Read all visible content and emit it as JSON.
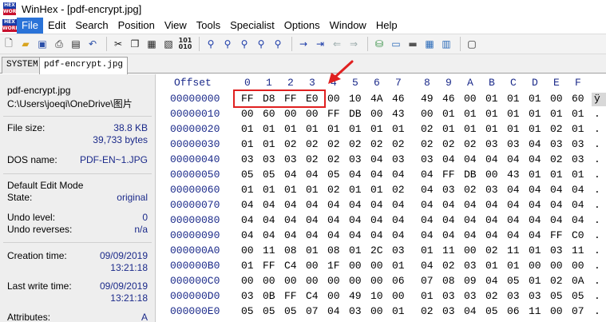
{
  "window": {
    "title": "WinHex - [pdf-encrypt.jpg]",
    "icon_top": "HEX",
    "icon_bottom": "WORKS"
  },
  "menu": {
    "items": [
      "File",
      "Edit",
      "Search",
      "Position",
      "View",
      "Tools",
      "Specialist",
      "Options",
      "Window",
      "Help"
    ],
    "active": "File"
  },
  "toolbar": {
    "icons": [
      "new-file-icon",
      "open-folder-icon",
      "save-icon",
      "print-icon",
      "properties-icon",
      "undo-icon",
      "cut-icon",
      "copy-icon",
      "paste-icon",
      "paste-special-icon",
      "binary-icon",
      "find-icon",
      "find-hex-icon",
      "replace-icon",
      "replace-hex-icon",
      "find-next-icon",
      "goto-icon",
      "go-back-icon",
      "go-forward-icon",
      "disk-editor-icon",
      "ram-editor-icon",
      "calculator-icon",
      "hash-icon",
      "settings-icon"
    ],
    "binary_label": "101\n010"
  },
  "tabs": {
    "system": "SYSTEM",
    "file": "pdf-encrypt.jpg"
  },
  "info": {
    "filename": "pdf-encrypt.jpg",
    "path": "C:\\Users\\joeqi\\OneDrive\\图片",
    "file_size_label": "File size:",
    "file_size_kb": "38.8 KB",
    "file_size_bytes": "39,733 bytes",
    "dos_name_label": "DOS name:",
    "dos_name": "PDF-EN~1.JPG",
    "edit_mode_label": "Default Edit Mode",
    "state_label": "State:",
    "state": "original",
    "undo_level_label": "Undo level:",
    "undo_level": "0",
    "undo_reverses_label": "Undo reverses:",
    "undo_reverses": "n/a",
    "creation_label": "Creation time:",
    "creation_date": "09/09/2019",
    "creation_time": "13:21:18",
    "last_write_label": "Last write time:",
    "last_write_date": "09/09/2019",
    "last_write_time": "13:21:18",
    "attributes_label": "Attributes:",
    "attributes": "A"
  },
  "hex": {
    "offset_label": "Offset",
    "columns": [
      "0",
      "1",
      "2",
      "3",
      "4",
      "5",
      "6",
      "7",
      "8",
      "9",
      "A",
      "B",
      "C",
      "D",
      "E",
      "F"
    ],
    "rows": [
      {
        "offset": "00000000",
        "bytes": [
          "FF",
          "D8",
          "FF",
          "E0",
          "00",
          "10",
          "4A",
          "46",
          "49",
          "46",
          "00",
          "01",
          "01",
          "01",
          "00",
          "60"
        ],
        "ascii": "ÿ"
      },
      {
        "offset": "00000010",
        "bytes": [
          "00",
          "60",
          "00",
          "00",
          "FF",
          "DB",
          "00",
          "43",
          "00",
          "01",
          "01",
          "01",
          "01",
          "01",
          "01",
          "01"
        ],
        "ascii": "."
      },
      {
        "offset": "00000020",
        "bytes": [
          "01",
          "01",
          "01",
          "01",
          "01",
          "01",
          "01",
          "01",
          "02",
          "01",
          "01",
          "01",
          "01",
          "01",
          "02",
          "01"
        ],
        "ascii": "."
      },
      {
        "offset": "00000030",
        "bytes": [
          "01",
          "01",
          "02",
          "02",
          "02",
          "02",
          "02",
          "02",
          "02",
          "02",
          "02",
          "03",
          "03",
          "04",
          "03",
          "03"
        ],
        "ascii": "."
      },
      {
        "offset": "00000040",
        "bytes": [
          "03",
          "03",
          "03",
          "02",
          "02",
          "03",
          "04",
          "03",
          "03",
          "04",
          "04",
          "04",
          "04",
          "04",
          "02",
          "03"
        ],
        "ascii": "."
      },
      {
        "offset": "00000050",
        "bytes": [
          "05",
          "05",
          "04",
          "04",
          "05",
          "04",
          "04",
          "04",
          "04",
          "FF",
          "DB",
          "00",
          "43",
          "01",
          "01",
          "01"
        ],
        "ascii": "."
      },
      {
        "offset": "00000060",
        "bytes": [
          "01",
          "01",
          "01",
          "01",
          "02",
          "01",
          "01",
          "02",
          "04",
          "03",
          "02",
          "03",
          "04",
          "04",
          "04",
          "04"
        ],
        "ascii": "."
      },
      {
        "offset": "00000070",
        "bytes": [
          "04",
          "04",
          "04",
          "04",
          "04",
          "04",
          "04",
          "04",
          "04",
          "04",
          "04",
          "04",
          "04",
          "04",
          "04",
          "04"
        ],
        "ascii": "."
      },
      {
        "offset": "00000080",
        "bytes": [
          "04",
          "04",
          "04",
          "04",
          "04",
          "04",
          "04",
          "04",
          "04",
          "04",
          "04",
          "04",
          "04",
          "04",
          "04",
          "04"
        ],
        "ascii": "."
      },
      {
        "offset": "00000090",
        "bytes": [
          "04",
          "04",
          "04",
          "04",
          "04",
          "04",
          "04",
          "04",
          "04",
          "04",
          "04",
          "04",
          "04",
          "04",
          "FF",
          "C0"
        ],
        "ascii": "."
      },
      {
        "offset": "000000A0",
        "bytes": [
          "00",
          "11",
          "08",
          "01",
          "08",
          "01",
          "2C",
          "03",
          "01",
          "11",
          "00",
          "02",
          "11",
          "01",
          "03",
          "11"
        ],
        "ascii": "."
      },
      {
        "offset": "000000B0",
        "bytes": [
          "01",
          "FF",
          "C4",
          "00",
          "1F",
          "00",
          "00",
          "01",
          "04",
          "02",
          "03",
          "01",
          "01",
          "00",
          "00",
          "00"
        ],
        "ascii": "."
      },
      {
        "offset": "000000C0",
        "bytes": [
          "00",
          "00",
          "00",
          "00",
          "00",
          "00",
          "00",
          "06",
          "07",
          "08",
          "09",
          "04",
          "05",
          "01",
          "02",
          "0A"
        ],
        "ascii": "."
      },
      {
        "offset": "000000D0",
        "bytes": [
          "03",
          "0B",
          "FF",
          "C4",
          "00",
          "49",
          "10",
          "00",
          "01",
          "03",
          "03",
          "02",
          "03",
          "03",
          "05",
          "05"
        ],
        "ascii": "."
      },
      {
        "offset": "000000E0",
        "bytes": [
          "05",
          "05",
          "05",
          "07",
          "04",
          "03",
          "00",
          "01",
          "02",
          "03",
          "04",
          "05",
          "06",
          "11",
          "00",
          "07"
        ],
        "ascii": "."
      }
    ]
  },
  "colors": {
    "offset_blue": "#1b2a8a",
    "menu_active": "#2a73d8",
    "highlight_red": "#e02020"
  }
}
